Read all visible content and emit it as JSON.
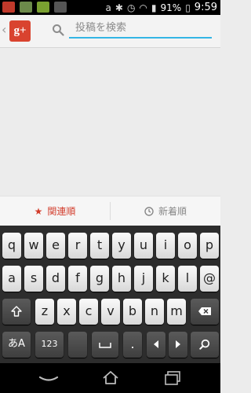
{
  "statusbar": {
    "battery": "91%",
    "time": "9:59"
  },
  "search": {
    "placeholder": "投稿を検索",
    "value": ""
  },
  "sort": {
    "relevance_label": "関連順",
    "newest_label": "新着順"
  },
  "keyboard": {
    "row1": [
      "q",
      "w",
      "e",
      "r",
      "t",
      "y",
      "u",
      "i",
      "o",
      "p"
    ],
    "row2": [
      "a",
      "s",
      "d",
      "f",
      "g",
      "h",
      "j",
      "k",
      "l",
      "@"
    ],
    "row3": [
      "z",
      "x",
      "c",
      "v",
      "b",
      "n",
      "m"
    ],
    "mode_label": "あA",
    "number_label": "123",
    "period_label": "."
  },
  "icons": [
    "google-plus-logo",
    "search-icon",
    "star-icon",
    "clock-icon",
    "shift-icon",
    "backspace-icon",
    "space-icon",
    "left-arrow-icon",
    "right-arrow-icon",
    "search-key-icon",
    "back-icon",
    "home-icon",
    "recents-icon"
  ],
  "colors": {
    "accent_red": "#d23b2a",
    "focus_blue": "#33b5e5",
    "brand_red": "#d9432f"
  }
}
